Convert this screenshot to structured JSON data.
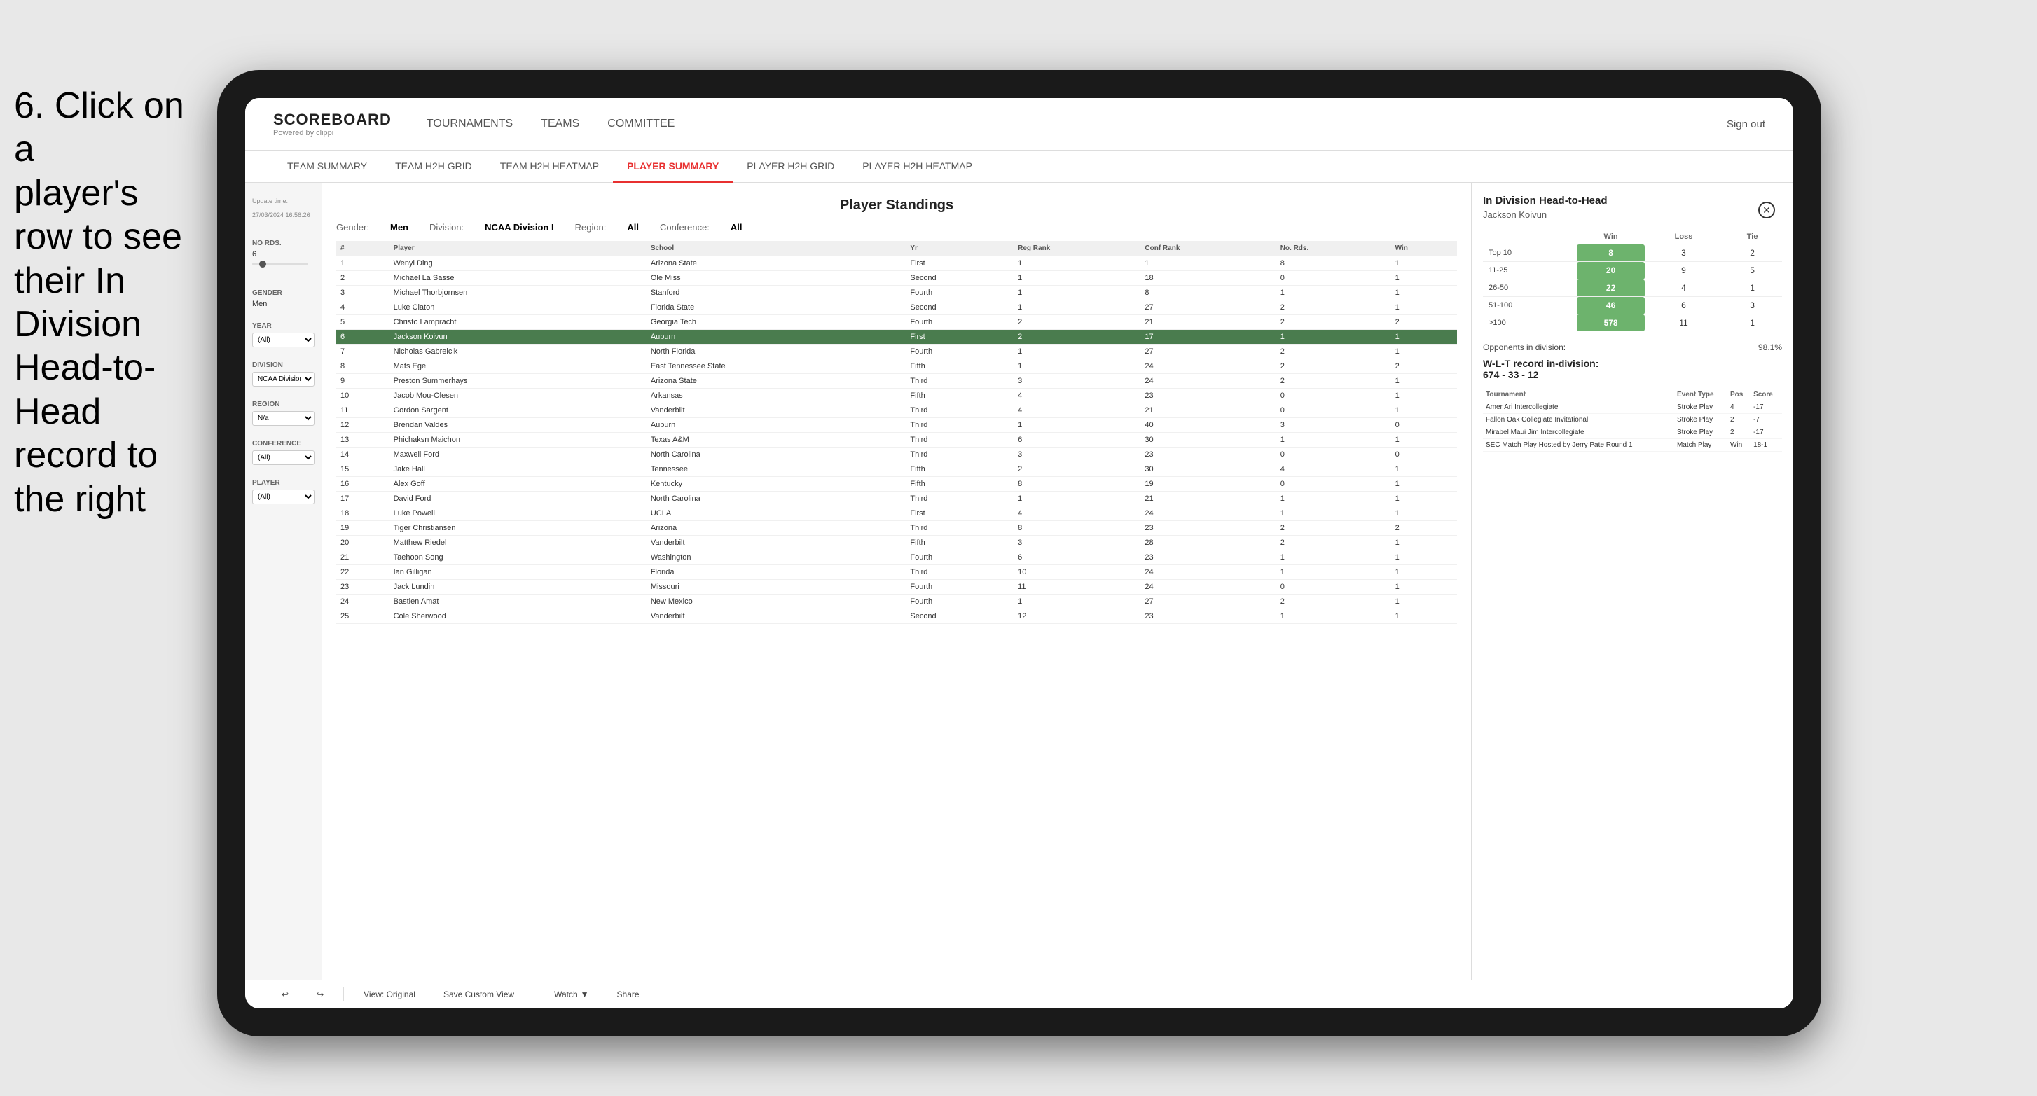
{
  "instruction": {
    "line1": "6. Click on a",
    "line2": "player's row to see",
    "line3": "their In Division",
    "line4": "Head-to-Head",
    "line5": "record to the right"
  },
  "nav": {
    "logo_title": "SCOREBOARD",
    "logo_subtitle": "Powered by clippi",
    "items": [
      "TOURNAMENTS",
      "TEAMS",
      "COMMITTEE"
    ],
    "sign_out": "Sign out"
  },
  "sub_nav": {
    "items": [
      "TEAM SUMMARY",
      "TEAM H2H GRID",
      "TEAM H2H HEATMAP",
      "PLAYER SUMMARY",
      "PLAYER H2H GRID",
      "PLAYER H2H HEATMAP"
    ],
    "active": "PLAYER SUMMARY"
  },
  "sidebar": {
    "update_time_label": "Update time:",
    "update_time": "27/03/2024 16:56:26",
    "no_rds_label": "No Rds.",
    "no_rds_value": "6",
    "gender_label": "Gender",
    "gender_value": "Men",
    "year_label": "Year",
    "year_value": "(All)",
    "division_label": "Division",
    "division_value": "NCAA Division I",
    "region_label": "Region",
    "region_value": "N/a",
    "conference_label": "Conference",
    "conference_value": "(All)",
    "player_label": "Player",
    "player_value": "(All)"
  },
  "standings": {
    "title": "Player Standings",
    "filters": {
      "gender_label": "Gender:",
      "gender_value": "Men",
      "division_label": "Division:",
      "division_value": "NCAA Division I",
      "region_label": "Region:",
      "region_value": "All",
      "conference_label": "Conference:",
      "conference_value": "All"
    },
    "columns": [
      "#",
      "Player",
      "School",
      "Yr",
      "Reg Rank",
      "Conf Rank",
      "No. Rds.",
      "Win"
    ],
    "rows": [
      {
        "num": 1,
        "player": "Wenyi Ding",
        "school": "Arizona State",
        "yr": "First",
        "reg": 1,
        "conf": 1,
        "rds": 8,
        "win": 1
      },
      {
        "num": 2,
        "player": "Michael La Sasse",
        "school": "Ole Miss",
        "yr": "Second",
        "reg": 1,
        "conf": 18,
        "rds": 0,
        "win": 1
      },
      {
        "num": 3,
        "player": "Michael Thorbjornsen",
        "school": "Stanford",
        "yr": "Fourth",
        "reg": 1,
        "conf": 8,
        "rds": 1,
        "win": 1
      },
      {
        "num": 4,
        "player": "Luke Claton",
        "school": "Florida State",
        "yr": "Second",
        "reg": 1,
        "conf": 27,
        "rds": 2,
        "win": 1
      },
      {
        "num": 5,
        "player": "Christo Lampracht",
        "school": "Georgia Tech",
        "yr": "Fourth",
        "reg": 2,
        "conf": 21,
        "rds": 2,
        "win": 2
      },
      {
        "num": 6,
        "player": "Jackson Koivun",
        "school": "Auburn",
        "yr": "First",
        "reg": 2,
        "conf": 17,
        "rds": 1,
        "win": 1,
        "highlighted": true
      },
      {
        "num": 7,
        "player": "Nicholas Gabrelcik",
        "school": "North Florida",
        "yr": "Fourth",
        "reg": 1,
        "conf": 27,
        "rds": 2,
        "win": 1
      },
      {
        "num": 8,
        "player": "Mats Ege",
        "school": "East Tennessee State",
        "yr": "Fifth",
        "reg": 1,
        "conf": 24,
        "rds": 2,
        "win": 2
      },
      {
        "num": 9,
        "player": "Preston Summerhays",
        "school": "Arizona State",
        "yr": "Third",
        "reg": 3,
        "conf": 24,
        "rds": 2,
        "win": 1
      },
      {
        "num": 10,
        "player": "Jacob Mou-Olesen",
        "school": "Arkansas",
        "yr": "Fifth",
        "reg": 4,
        "conf": 23,
        "rds": 0,
        "win": 1
      },
      {
        "num": 11,
        "player": "Gordon Sargent",
        "school": "Vanderbilt",
        "yr": "Third",
        "reg": 4,
        "conf": 21,
        "rds": 0,
        "win": 1
      },
      {
        "num": 12,
        "player": "Brendan Valdes",
        "school": "Auburn",
        "yr": "Third",
        "reg": 1,
        "conf": 40,
        "rds": 3,
        "win": 0
      },
      {
        "num": 13,
        "player": "Phichaksn Maichon",
        "school": "Texas A&M",
        "yr": "Third",
        "reg": 6,
        "conf": 30,
        "rds": 1,
        "win": 1
      },
      {
        "num": 14,
        "player": "Maxwell Ford",
        "school": "North Carolina",
        "yr": "Third",
        "reg": 3,
        "conf": 23,
        "rds": 0,
        "win": 0
      },
      {
        "num": 15,
        "player": "Jake Hall",
        "school": "Tennessee",
        "yr": "Fifth",
        "reg": 2,
        "conf": 30,
        "rds": 4,
        "win": 1
      },
      {
        "num": 16,
        "player": "Alex Goff",
        "school": "Kentucky",
        "yr": "Fifth",
        "reg": 8,
        "conf": 19,
        "rds": 0,
        "win": 1
      },
      {
        "num": 17,
        "player": "David Ford",
        "school": "North Carolina",
        "yr": "Third",
        "reg": 1,
        "conf": 21,
        "rds": 1,
        "win": 1
      },
      {
        "num": 18,
        "player": "Luke Powell",
        "school": "UCLA",
        "yr": "First",
        "reg": 4,
        "conf": 24,
        "rds": 1,
        "win": 1
      },
      {
        "num": 19,
        "player": "Tiger Christiansen",
        "school": "Arizona",
        "yr": "Third",
        "reg": 8,
        "conf": 23,
        "rds": 2,
        "win": 2
      },
      {
        "num": 20,
        "player": "Matthew Riedel",
        "school": "Vanderbilt",
        "yr": "Fifth",
        "reg": 3,
        "conf": 28,
        "rds": 2,
        "win": 1
      },
      {
        "num": 21,
        "player": "Taehoon Song",
        "school": "Washington",
        "yr": "Fourth",
        "reg": 6,
        "conf": 23,
        "rds": 1,
        "win": 1
      },
      {
        "num": 22,
        "player": "Ian Gilligan",
        "school": "Florida",
        "yr": "Third",
        "reg": 10,
        "conf": 24,
        "rds": 1,
        "win": 1
      },
      {
        "num": 23,
        "player": "Jack Lundin",
        "school": "Missouri",
        "yr": "Fourth",
        "reg": 11,
        "conf": 24,
        "rds": 0,
        "win": 1
      },
      {
        "num": 24,
        "player": "Bastien Amat",
        "school": "New Mexico",
        "yr": "Fourth",
        "reg": 1,
        "conf": 27,
        "rds": 2,
        "win": 1
      },
      {
        "num": 25,
        "player": "Cole Sherwood",
        "school": "Vanderbilt",
        "yr": "Second",
        "reg": 12,
        "conf": 23,
        "rds": 1,
        "win": 1
      }
    ]
  },
  "h2h": {
    "title": "In Division Head-to-Head",
    "player": "Jackson Koivun",
    "table_headers": [
      "",
      "Win",
      "Loss",
      "Tie"
    ],
    "rows": [
      {
        "rank": "Top 10",
        "win": 8,
        "loss": 3,
        "tie": 2
      },
      {
        "rank": "11-25",
        "win": 20,
        "loss": 9,
        "tie": 5
      },
      {
        "rank": "26-50",
        "win": 22,
        "loss": 4,
        "tie": 1
      },
      {
        "rank": "51-100",
        "win": 46,
        "loss": 6,
        "tie": 3
      },
      {
        "rank": ">100",
        "win": 578,
        "loss": 11,
        "tie": 1
      }
    ],
    "opponents_label": "Opponents in division:",
    "opponents_pct": "98.1%",
    "wlt_label": "W-L-T record in-division:",
    "wlt_record": "674 - 33 - 12",
    "tournament_columns": [
      "Tournament",
      "Event Type",
      "Pos",
      "Score"
    ],
    "tournament_rows": [
      {
        "tournament": "Amer Ari Intercollegiate",
        "type": "Stroke Play",
        "pos": 4,
        "score": "-17"
      },
      {
        "tournament": "Fallon Oak Collegiate Invitational",
        "type": "Stroke Play",
        "pos": 2,
        "score": "-7"
      },
      {
        "tournament": "Mirabel Maui Jim Intercollegiate",
        "type": "Stroke Play",
        "pos": 2,
        "score": "-17"
      },
      {
        "tournament": "SEC Match Play Hosted by Jerry Pate Round 1",
        "type": "Match Play",
        "pos": "Win",
        "score": "18-1"
      }
    ]
  },
  "toolbar": {
    "view_original": "View: Original",
    "save_custom": "Save Custom View",
    "watch": "Watch",
    "share": "Share"
  }
}
